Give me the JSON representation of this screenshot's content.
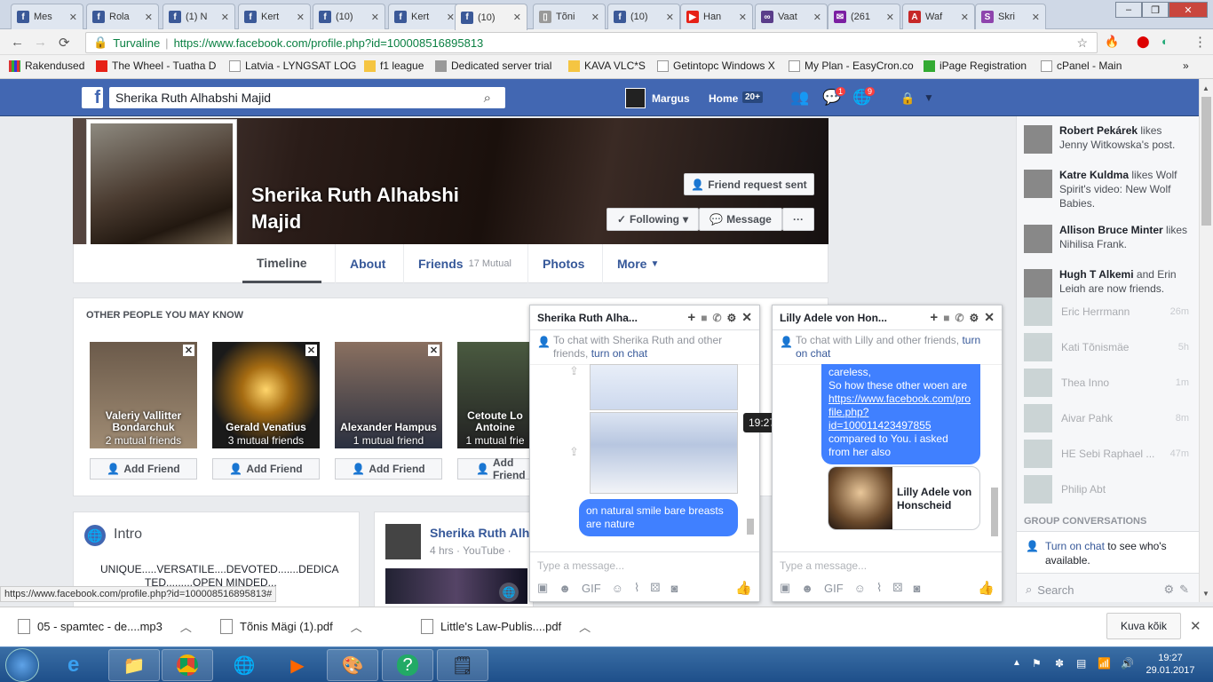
{
  "tabs": [
    {
      "label": "Mes",
      "color": "#3b5998",
      "glyph": "f"
    },
    {
      "label": "Rola",
      "color": "#3b5998",
      "glyph": "f"
    },
    {
      "label": "(1) N",
      "color": "#3b5998",
      "glyph": "f"
    },
    {
      "label": "Kert",
      "color": "#3b5998",
      "glyph": "f"
    },
    {
      "label": "(10)",
      "color": "#3b5998",
      "glyph": "f"
    },
    {
      "label": "Kert",
      "color": "#3b5998",
      "glyph": "f"
    },
    {
      "label": "(10)",
      "color": "#3b5998",
      "glyph": "f"
    },
    {
      "label": "Tõni",
      "color": "#999999",
      "glyph": "▯"
    },
    {
      "label": "(10)",
      "color": "#3b5998",
      "glyph": "f"
    },
    {
      "label": "Han",
      "color": "#e62117",
      "glyph": "▶"
    },
    {
      "label": "Vaat",
      "color": "#5a3d8a",
      "glyph": "∞"
    },
    {
      "label": "(261",
      "color": "#7b1fa2",
      "glyph": "✉"
    },
    {
      "label": "Waf",
      "color": "#c62828",
      "glyph": "A"
    },
    {
      "label": "Skri",
      "color": "#8e44ad",
      "glyph": "S"
    }
  ],
  "address": {
    "secure_label": "Turvaline",
    "url": "https://www.facebook.com/profile.php?id=100008516895813"
  },
  "bookmarks": [
    {
      "label": "Rakendused",
      "icon": "apps-icon"
    },
    {
      "label": "The Wheel - Tuatha D",
      "icon": "youtube-icon"
    },
    {
      "label": "Latvia - LYNGSAT LOG",
      "icon": "page-icon"
    },
    {
      "label": "f1 league",
      "icon": "folder-icon"
    },
    {
      "label": "Dedicated server trial",
      "icon": "io-icon"
    },
    {
      "label": "KAVA VLC*S",
      "icon": "folder-icon"
    },
    {
      "label": "Getintopc Windows X",
      "icon": "page-icon"
    },
    {
      "label": "My Plan - EasyCron.co",
      "icon": "page-icon"
    },
    {
      "label": "iPage Registration",
      "icon": "green-icon"
    },
    {
      "label": "cPanel - Main",
      "icon": "page-icon"
    }
  ],
  "fb": {
    "search_value": "Sherika Ruth Alhabshi Majid",
    "user": "Margus",
    "home": "Home",
    "home_count": "20+",
    "msg_badge": "1",
    "notif_badge": "9"
  },
  "profile": {
    "name_line1": "Sherika Ruth Alhabshi",
    "name_line2": "Majid",
    "friend_request": "Friend request sent",
    "following": "Following",
    "message": "Message",
    "more_dots": "···",
    "nav": {
      "timeline": "Timeline",
      "about": "About",
      "friends": "Friends",
      "friends_count": "17 Mutual",
      "photos": "Photos",
      "more": "More"
    }
  },
  "pymk": {
    "title": "OTHER PEOPLE YOU MAY KNOW",
    "add_label": "Add Friend",
    "people": [
      {
        "name": "Valeriy Vallitter Bondarchuk",
        "mutual": "2 mutual friends"
      },
      {
        "name": "Gerald Venatius",
        "mutual": "3 mutual friends"
      },
      {
        "name": "Alexander Hampus",
        "mutual": "1 mutual friend"
      },
      {
        "name": "Cetoute Lo Antoine",
        "mutual": "1 mutual frie"
      }
    ]
  },
  "intro": {
    "title": "Intro",
    "text1": "UNIQUE.....VERSATILE....DEVOTED.......DEDICA",
    "text2": "TED.........OPEN MINDED..."
  },
  "post": {
    "author": "Sherika Ruth Alh",
    "meta": "4 hrs · YouTube ·"
  },
  "chat1": {
    "name": "Sherika Ruth Alha...",
    "hint_a": "To chat with Sherika Ruth and other friends,",
    "hint_link": "turn on chat",
    "bubble": "on natural smile bare breasts are nature",
    "time": "19:27",
    "placeholder": "Type a message..."
  },
  "chat2": {
    "name": "Lilly Adele von Hon...",
    "hint_a": "To chat with Lilly and other friends,",
    "hint_link": "turn on chat",
    "bubble_lines": [
      "careless,",
      "So how these other woen are"
    ],
    "link": "https://www.facebook.com/profile.php?id=100011423497855",
    "link_lines": [
      "https://www.facebook.com/pro",
      "file.php?",
      "id=100011423497855"
    ],
    "bubble_tail": [
      "compared to You. i  asked",
      "from her also"
    ],
    "card_name": "Lilly Adele von Honscheid",
    "placeholder": "Type a message..."
  },
  "ticker": [
    {
      "name": "Robert Pekárek",
      "text": " likes Jenny Witkowska's post."
    },
    {
      "name": "Katre Kuldma",
      "text": " likes Wolf Spirit's video: New Wolf Babies."
    },
    {
      "name": "Allison Bruce Minter",
      "text": " likes Nihilisa Frank."
    },
    {
      "name": "Hugh T Alkemi",
      "text": " and Erin Leigh are now friends."
    }
  ],
  "contacts": [
    {
      "name": "Eric Herrmann",
      "time": "26m"
    },
    {
      "name": "Kati Tõnismäe",
      "time": "5h"
    },
    {
      "name": "Thea Inno",
      "time": "1m"
    },
    {
      "name": "Aivar Pahk",
      "time": "8m"
    },
    {
      "name": "HE Sebi Raphael ...",
      "time": "47m"
    },
    {
      "name": "Philip Abt",
      "time": ""
    }
  ],
  "rail": {
    "group_title": "GROUP CONVERSATIONS",
    "turn_on": "Turn on chat",
    "turn_on_tail": " to see who's available.",
    "search": "Search"
  },
  "status_url": "https://www.facebook.com/profile.php?id=100008516895813#",
  "downloads": [
    {
      "name": "05 - spamtec - de....mp3"
    },
    {
      "name": "Tõnis Mägi (1).pdf"
    },
    {
      "name": "Little's Law-Publis....pdf"
    }
  ],
  "show_all": "Kuva kõik",
  "clock": {
    "time": "19:27",
    "date": "29.01.2017"
  }
}
